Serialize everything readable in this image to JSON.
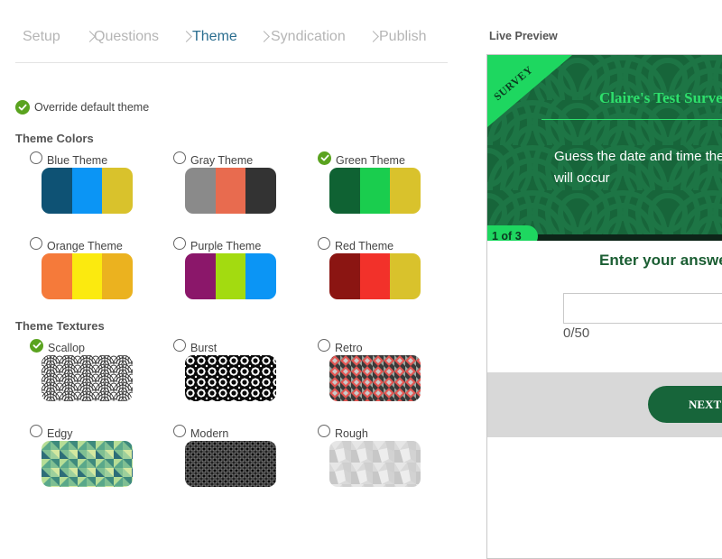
{
  "wizard": {
    "steps": [
      {
        "label": "Setup"
      },
      {
        "label": "Questions"
      },
      {
        "label": "Theme"
      },
      {
        "label": "Syndication"
      },
      {
        "label": "Publish"
      }
    ],
    "active_step": "Theme"
  },
  "override": {
    "label": "Override default theme",
    "checked": true
  },
  "theme_colors": {
    "title": "Theme Colors",
    "options": [
      {
        "label": "Blue Theme",
        "selected": false,
        "colors": [
          "#0e5274",
          "#0b95f5",
          "#d9c22c"
        ]
      },
      {
        "label": "Gray Theme",
        "selected": false,
        "colors": [
          "#8a8a8a",
          "#e86b4f",
          "#333333"
        ]
      },
      {
        "label": "Green Theme",
        "selected": true,
        "colors": [
          "#0f6233",
          "#1acd4e",
          "#d9c22c"
        ]
      },
      {
        "label": "Orange Theme",
        "selected": false,
        "colors": [
          "#f57a3a",
          "#fbea0f",
          "#ebb21f"
        ]
      },
      {
        "label": "Purple Theme",
        "selected": false,
        "colors": [
          "#8b176a",
          "#a3db10",
          "#0b95f5"
        ]
      },
      {
        "label": "Red Theme",
        "selected": false,
        "colors": [
          "#8b1512",
          "#f2312a",
          "#d9c22c"
        ]
      }
    ]
  },
  "theme_textures": {
    "title": "Theme Textures",
    "options": [
      {
        "label": "Scallop",
        "selected": true,
        "texture": "scallop"
      },
      {
        "label": "Burst",
        "selected": false,
        "texture": "burst"
      },
      {
        "label": "Retro",
        "selected": false,
        "texture": "retro"
      },
      {
        "label": "Edgy",
        "selected": false,
        "texture": "edgy"
      },
      {
        "label": "Modern",
        "selected": false,
        "texture": "modern"
      },
      {
        "label": "Rough",
        "selected": false,
        "texture": "rough"
      }
    ]
  },
  "preview": {
    "label": "Live Preview",
    "ribbon": "SURVEY",
    "title": "Claire's Test Survey",
    "question": "Guess the date and time the event will occur",
    "progress": "1 of 3",
    "answer_label": "Enter your answer",
    "input_value": "",
    "char_count": "0/50",
    "next_label": "NEXT",
    "colors": {
      "primary": "#17653a",
      "accent": "#1ed760"
    }
  }
}
